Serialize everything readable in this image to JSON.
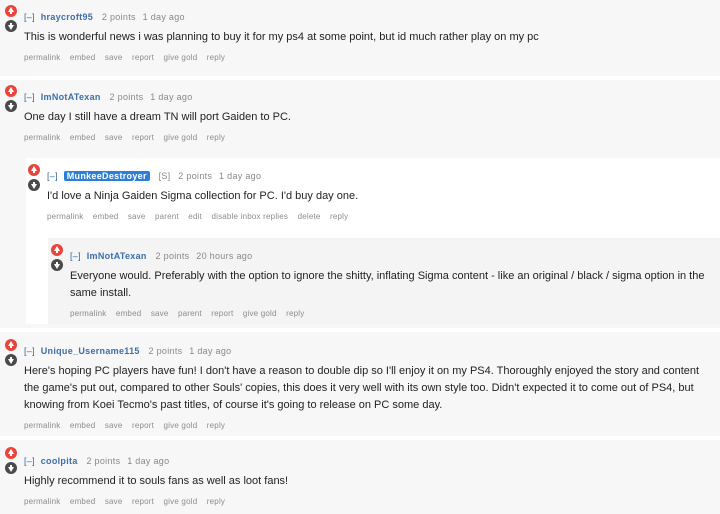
{
  "comments": [
    {
      "toggle": "[–]",
      "author": "hraycroft95",
      "score": "2 points",
      "time": "1 day ago",
      "text": "This is wonderful news i was planning to buy it for my ps4 at some point, but id much rather play on my pc",
      "buttons": [
        "permalink",
        "embed",
        "save",
        "report",
        "give gold",
        "reply"
      ]
    },
    {
      "toggle": "[–]",
      "author": "ImNotATexan",
      "score": "2 points",
      "time": "1 day ago",
      "text": "One day I still have a dream TN will port Gaiden to PC.",
      "buttons": [
        "permalink",
        "embed",
        "save",
        "report",
        "give gold",
        "reply"
      ]
    },
    {
      "toggle": "[–]",
      "author": "MunkeeDestroyer",
      "flair": "[S]",
      "score": "2 points",
      "time": "1 day ago",
      "text": "I'd love a Ninja Gaiden Sigma collection for PC. I'd buy day one.",
      "buttons": [
        "permalink",
        "embed",
        "save",
        "parent",
        "edit",
        "disable inbox replies",
        "delete",
        "reply"
      ]
    },
    {
      "toggle": "[–]",
      "author": "ImNotATexan",
      "score": "2 points",
      "time": "20 hours ago",
      "text": "Everyone would. Preferably with the option to ignore the shitty, inflating Sigma content - like an original / black / sigma option in the same install.",
      "buttons": [
        "permalink",
        "embed",
        "save",
        "parent",
        "report",
        "give gold",
        "reply"
      ]
    },
    {
      "toggle": "[–]",
      "author": "Unique_Username115",
      "score": "2 points",
      "time": "1 day ago",
      "text": "Here's hoping PC players have fun! I don't have a reason to double dip so I'll enjoy it on my PS4. Thoroughly enjoyed the story and content the game's put out, compared to other Souls' copies, this does it very well with its own style too. Didn't expected it to come out of PS4, but knowing from Koei Tecmo's past titles, of course it's going to release on PC some day.",
      "buttons": [
        "permalink",
        "embed",
        "save",
        "report",
        "give gold",
        "reply"
      ]
    },
    {
      "toggle": "[–]",
      "author": "coolpita",
      "score": "2 points",
      "time": "1 day ago",
      "text": "Highly recommend it to souls fans as well as loot fans!",
      "buttons": [
        "permalink",
        "embed",
        "save",
        "report",
        "give gold",
        "reply"
      ]
    }
  ]
}
